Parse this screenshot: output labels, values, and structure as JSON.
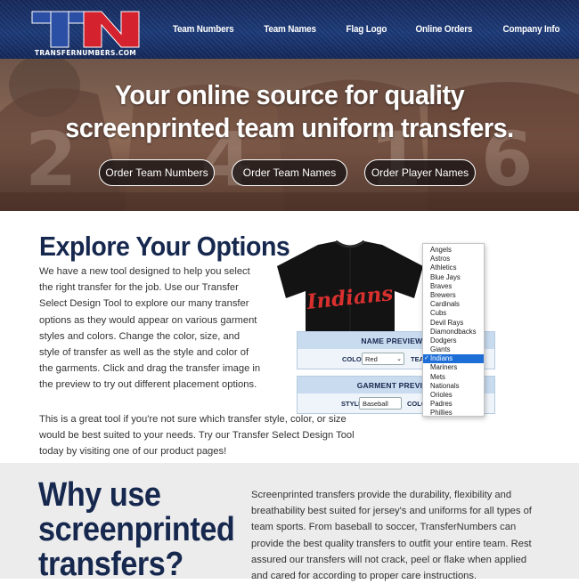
{
  "header": {
    "logo_letters": "TN",
    "logo_text": "TRANSFERNUMBERS.COM",
    "nav": [
      "Team Numbers",
      "Team Names",
      "Flag Logo",
      "Online Orders",
      "Company Info"
    ]
  },
  "hero": {
    "title_line1": "Your online source for quality",
    "title_line2": "screenprinted team uniform transfers.",
    "buttons": [
      "Order Team Numbers",
      "Order Team Names",
      "Order Player Names"
    ],
    "jersey_numbers": [
      "2",
      "4",
      "1",
      "6"
    ]
  },
  "explore": {
    "heading": "Explore Your Options",
    "paragraph1": "We have a new tool designed to help you select the right transfer for the job. Use our Transfer Select Design Tool to explore our many transfer options as they would appear on various garment styles and colors. Change the color, size, and style of transfer as well as the style and color of the garments. Click and drag the transfer image in the preview to try out different placement options.",
    "paragraph2": "This is a great tool if you're not sure which transfer style, color, or size would be best suited to your needs. Try our Transfer Select Design Tool today by visiting one of our product pages!",
    "jersey_text": "Indians",
    "name_preview": {
      "header": "NAME PREVIEW O",
      "color_label": "COLOR:",
      "color_value": "Red",
      "team_label": "TEAM"
    },
    "garment_preview": {
      "header": "GARMENT PREVIEW",
      "style_label": "STYLE:",
      "style_value": "Baseball Jer",
      "color_label": "COLO"
    },
    "team_dropdown": {
      "items": [
        "Angels",
        "Astros",
        "Athletics",
        "Blue Jays",
        "Braves",
        "Brewers",
        "Cardinals",
        "Cubs",
        "Devil Rays",
        "Diamondbacks",
        "Dodgers",
        "Giants",
        "Indians",
        "Mariners",
        "Mets",
        "Nationals",
        "Orioles",
        "Padres",
        "Phillies"
      ],
      "selected": "Indians"
    }
  },
  "why": {
    "heading_lines": [
      "Why use",
      "screenprinted",
      "transfers?"
    ],
    "paragraph": "Screenprinted transfers provide the durability, flexibility and breathability best suited for jersey's and uniforms for all types of team sports. From baseball to soccer, TransferNumbers can provide the best quality transfers to outfit your entire team. Rest assured our transfers will not crack, peel or flake when applied and cared for according to proper care instructions."
  },
  "colors": {
    "header_blue": "#1c3a78",
    "logo_red": "#d4232e",
    "heading_navy": "#17284f",
    "jersey_red": "#d8302f",
    "dropdown_selected": "#1e6ed8",
    "panel_blue": "#c8dbef"
  }
}
